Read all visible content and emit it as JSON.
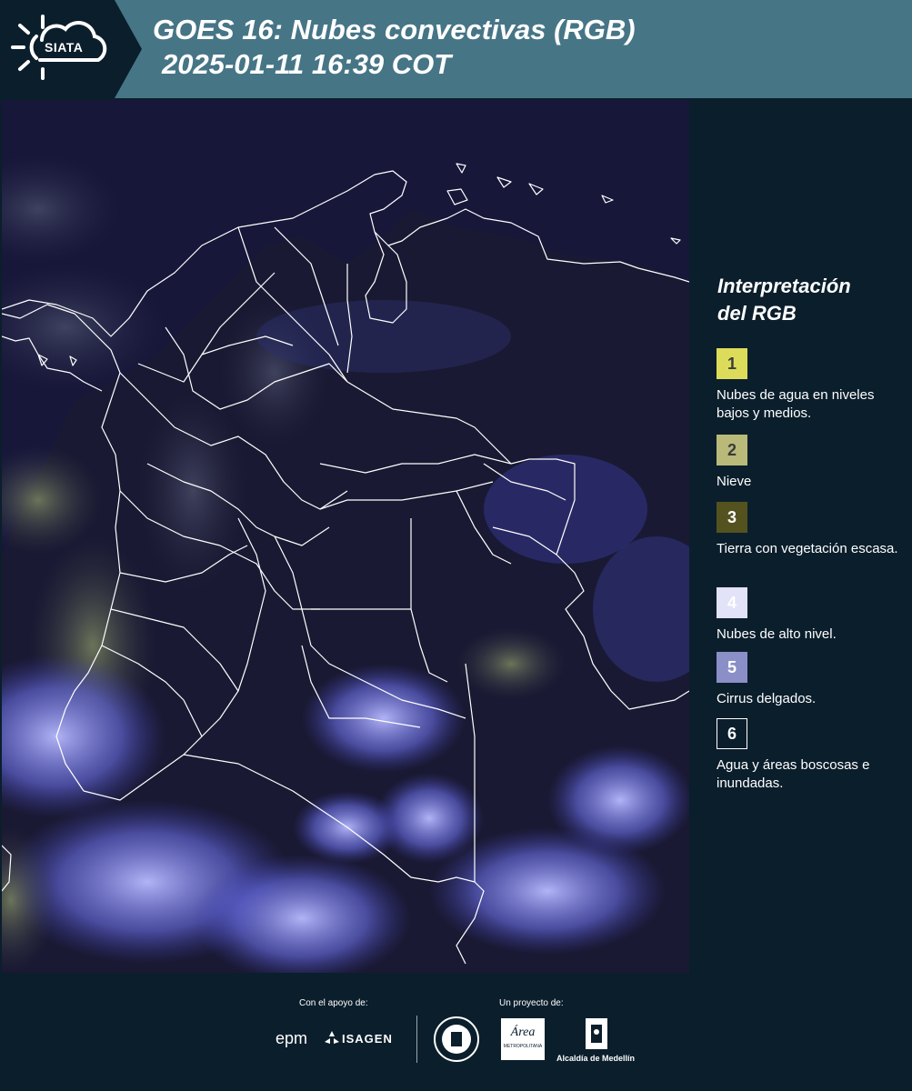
{
  "header": {
    "logo": "SIATA",
    "title_line1": "GOES 16: Nubes convectivas (RGB)",
    "title_line2": "2025-01-11 16:39 COT"
  },
  "map": {
    "type": "satellite-rgb-composite",
    "background_color": "#17173a",
    "border_color": "#ffffff"
  },
  "legend": {
    "title_line1": "Interpretación",
    "title_line2": "del RGB",
    "items": [
      {
        "number": "1",
        "label": "Nubes de agua en niveles bajos y medios.",
        "color": "#dcdc5a"
      },
      {
        "number": "2",
        "label": "Nieve",
        "color": "#b9b97a"
      },
      {
        "number": "3",
        "label": "Tierra con vegetación escasa.",
        "color": "#54521f"
      },
      {
        "number": "4",
        "label": "Nubes de alto nivel.",
        "color": "#e2e2f8"
      },
      {
        "number": "5",
        "label": "Cirrus delgados.",
        "color": "#8b8fc8"
      },
      {
        "number": "6",
        "label": "Agua y áreas boscosas e inundadas.",
        "color": "#0b1e2c"
      }
    ]
  },
  "footer": {
    "support_caption": "Con el apoyo de:",
    "project_caption": "Un proyecto de:",
    "epm": "epm",
    "isagen": "ISAGEN",
    "metropolitana_logo": "Área",
    "metropolitana_small": "METROPOLITANA",
    "alcaldia": "Alcaldía de Medellín"
  }
}
